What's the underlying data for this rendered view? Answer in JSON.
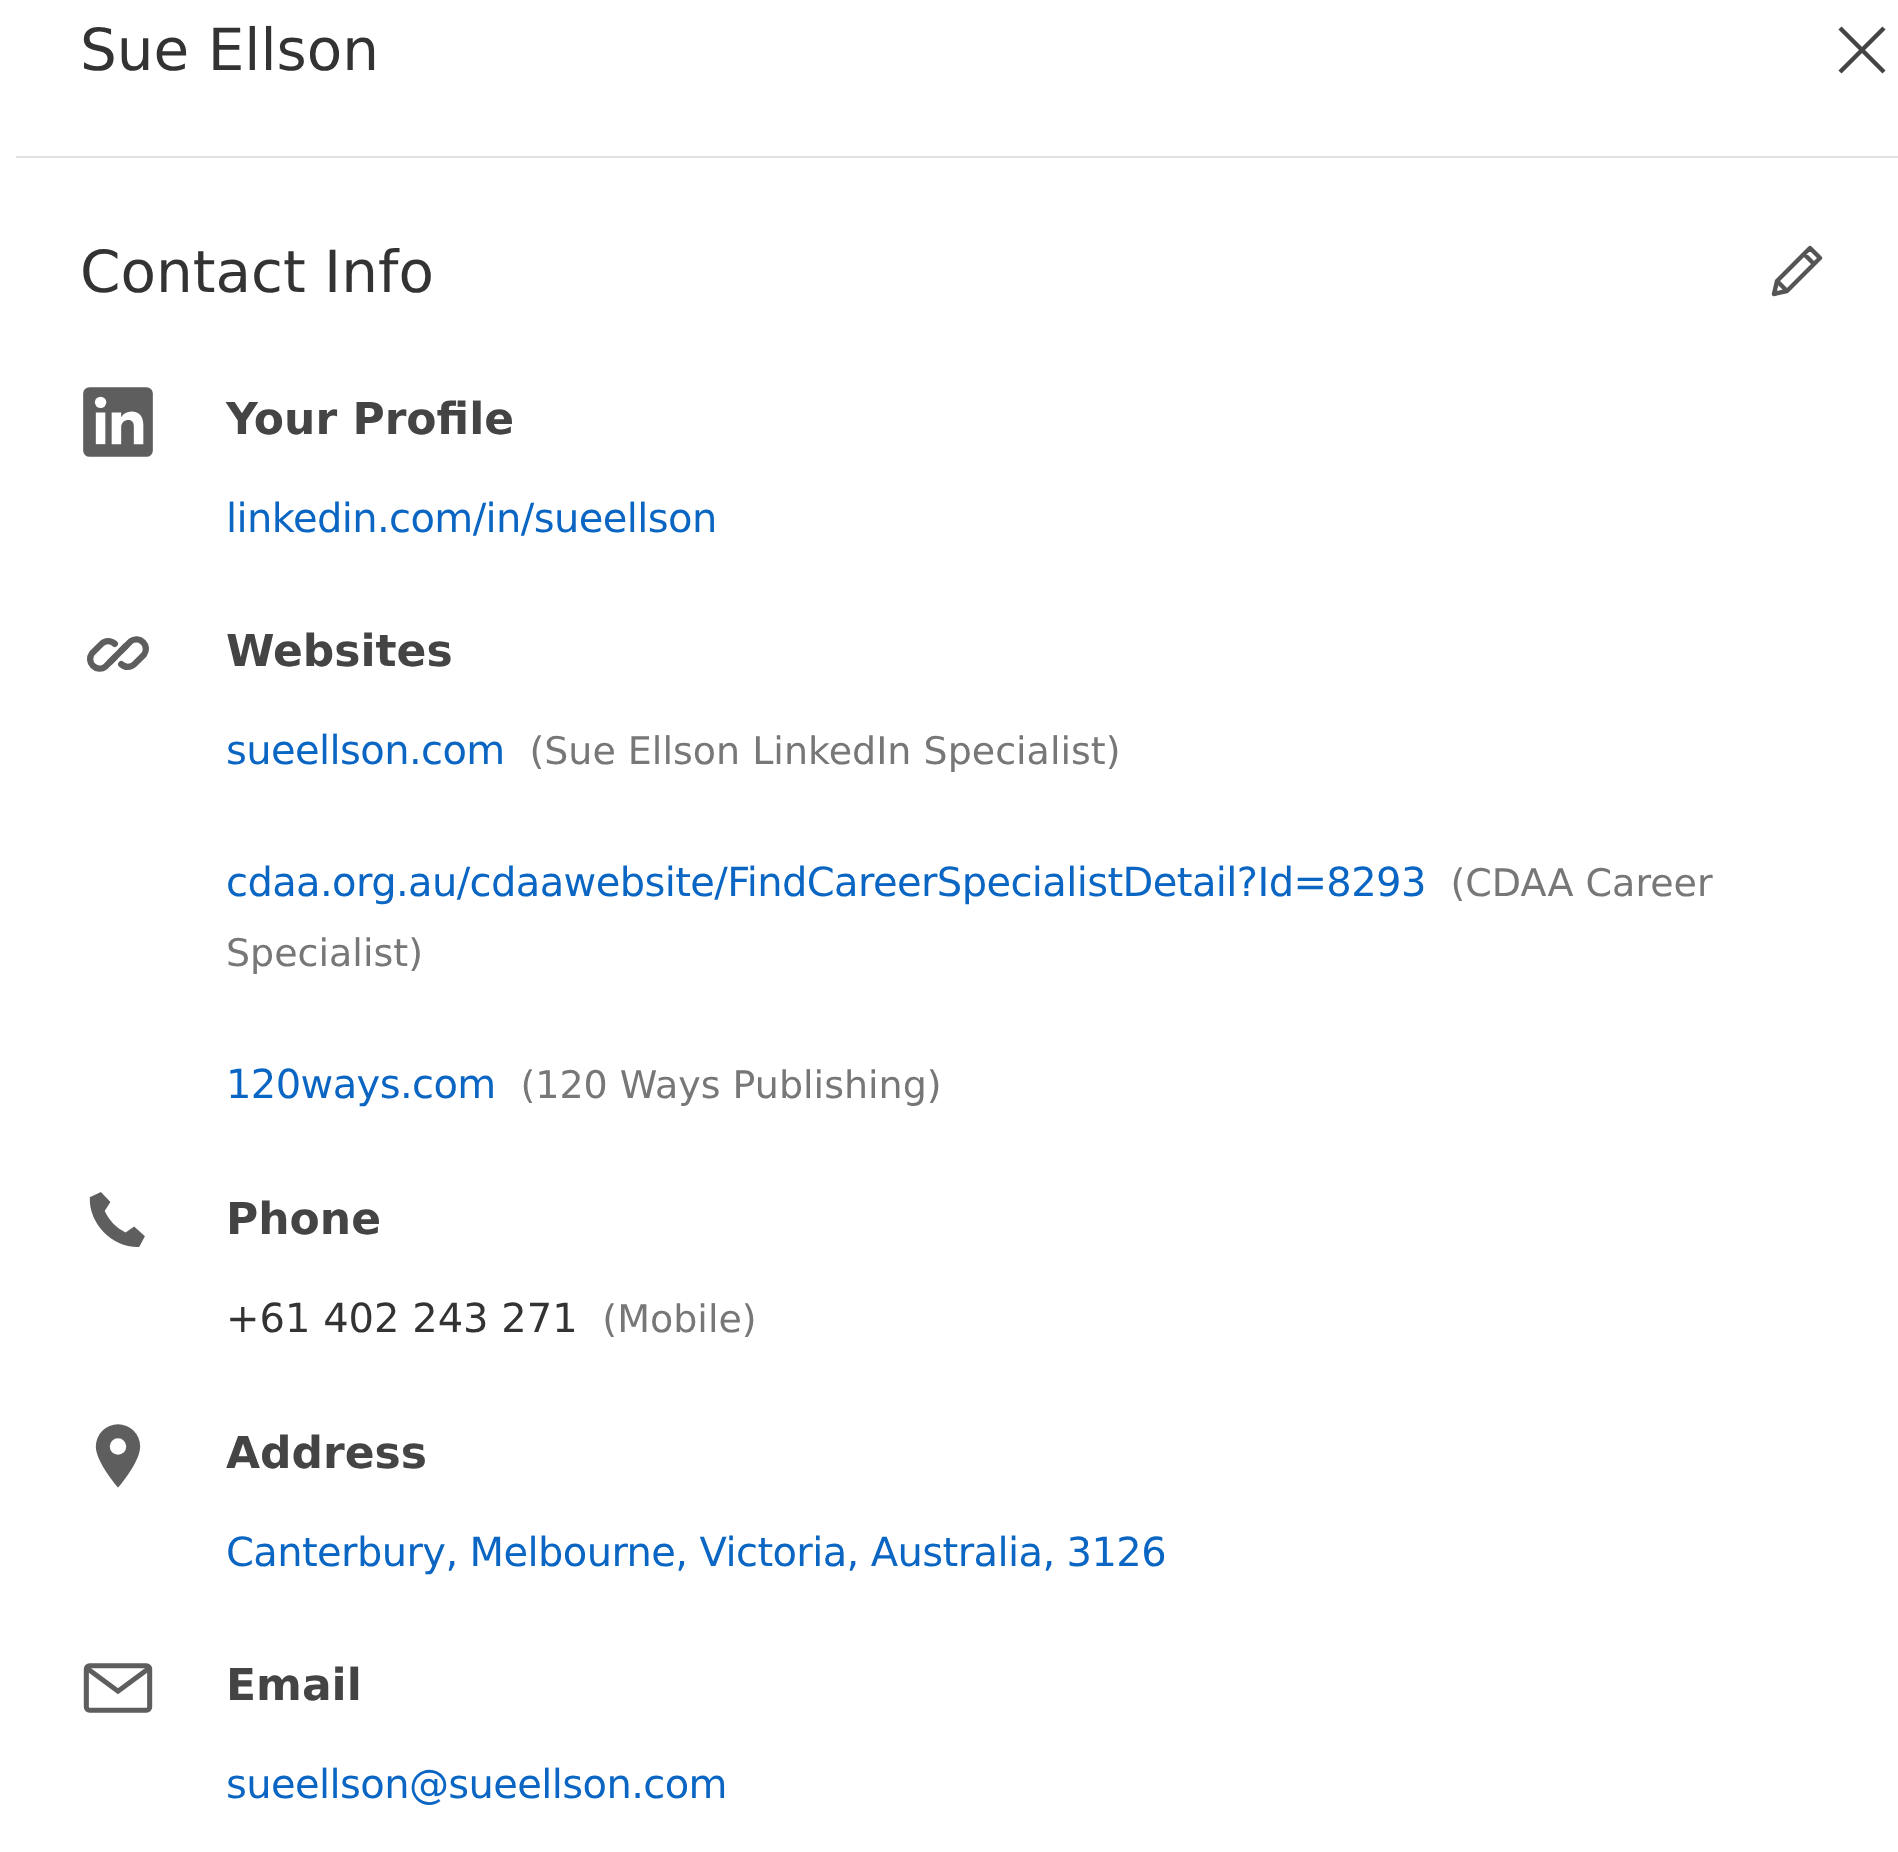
{
  "header": {
    "title": "Sue Ellson"
  },
  "section_title": "Contact Info",
  "sections": [
    {
      "kind": "profile",
      "heading": "Your Profile",
      "entries": [
        {
          "link": "linkedin.com/in/sueellson"
        }
      ]
    },
    {
      "kind": "websites",
      "heading": "Websites",
      "entries": [
        {
          "link": "sueellson.com",
          "note": "(Sue Ellson LinkedIn Specialist)"
        },
        {
          "link": "cdaa.org.au/cdaawebsite/FindCareerSpecialistDetail?Id=8293",
          "note": "(CDAA Career Specialist)"
        },
        {
          "link": "120ways.com",
          "note": "(120 Ways Publishing)"
        }
      ]
    },
    {
      "kind": "phone",
      "heading": "Phone",
      "entries": [
        {
          "text": "+61 402 243 271",
          "note": "(Mobile)"
        }
      ]
    },
    {
      "kind": "address",
      "heading": "Address",
      "entries": [
        {
          "link": "Canterbury, Melbourne, Victoria, Australia, 3126"
        }
      ]
    },
    {
      "kind": "email",
      "heading": "Email",
      "entries": [
        {
          "link": "sueellson@sueellson.com"
        }
      ]
    }
  ]
}
